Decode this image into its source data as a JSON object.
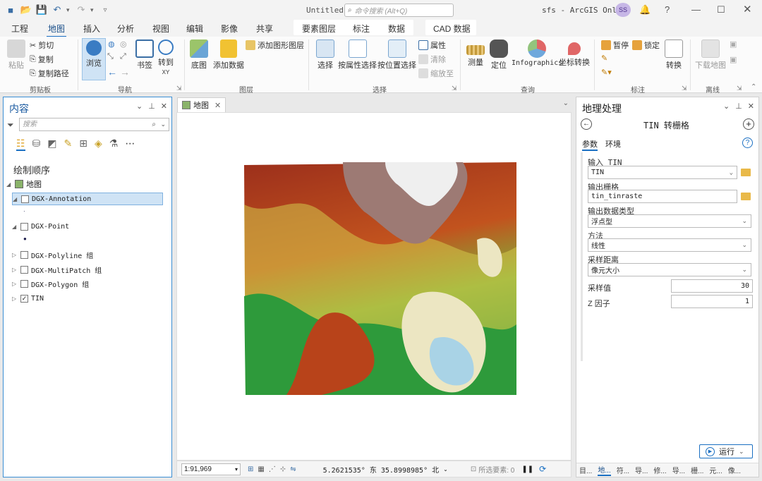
{
  "title_bar": {
    "doc_title": "Untitled",
    "search_placeholder": "命令搜索 (Alt+Q)",
    "user": "sfs - ArcGIS Online",
    "avatar_initials": "SS",
    "help": "?"
  },
  "ribbon_tabs": [
    "工程",
    "地图",
    "插入",
    "分析",
    "视图",
    "编辑",
    "影像",
    "共享",
    "要素图层",
    "标注",
    "数据",
    "CAD 数据"
  ],
  "active_tab": "地图",
  "ribbon": {
    "clipboard": {
      "paste": "粘贴",
      "cut": "剪切",
      "copy": "复制",
      "copy_path": "复制路径",
      "label": "剪贴板"
    },
    "nav": {
      "explore": "浏览",
      "bookmarks": "书签",
      "goto": "转到",
      "goto_sub": "XY",
      "label": "导航"
    },
    "layer": {
      "basemap": "底图",
      "add_data": "添加数据",
      "add_graphics": "添加图形图层",
      "label": "图层"
    },
    "selection": {
      "select": "选择",
      "by_attr": "按属性选择",
      "by_loc": "按位置选择",
      "attributes": "属性",
      "clear": "清除",
      "zoom_to": "缩放至",
      "label": "选择"
    },
    "inquiry": {
      "measure": "测量",
      "locate": "定位",
      "infographics": "Infographics",
      "coord": "坐标转换",
      "label": "查询"
    },
    "labeling": {
      "pause": "暂停",
      "lock": "锁定",
      "convert": "转换",
      "label": "标注"
    },
    "offline": {
      "download": "下载地图",
      "label": "离线"
    }
  },
  "contents": {
    "title": "内容",
    "search_placeholder": "搜索",
    "draw_order": "绘制顺序",
    "map_root": "地图",
    "layers": [
      {
        "name": "DGX-Annotation",
        "checked": false,
        "expanded": true,
        "selected": true
      },
      {
        "name": "DGX-Point",
        "checked": false,
        "expanded": true
      },
      {
        "name": "DGX-Polyline 组",
        "checked": false,
        "expanded": false
      },
      {
        "name": "DGX-MultiPatch 组",
        "checked": false,
        "expanded": false
      },
      {
        "name": "DGX-Polygon 组",
        "checked": false,
        "expanded": false
      },
      {
        "name": "TIN",
        "checked": true,
        "expanded": false
      }
    ]
  },
  "map": {
    "tab": "地图",
    "scale": "1:91,969",
    "coords": "5.2621535° 东  35.8998985° 北",
    "selected_features": "所选要素: 0"
  },
  "geoprocessing": {
    "title": "地理处理",
    "tool": "TIN 转栅格",
    "tab_params": "参数",
    "tab_env": "环境",
    "fields": {
      "input_tin_label": "输入 TIN",
      "input_tin": "TIN",
      "output_raster_label": "输出栅格",
      "output_raster": "tin_tinraste",
      "data_type_label": "输出数据类型",
      "data_type": "浮点型",
      "method_label": "方法",
      "method": "线性",
      "sampling_label": "采样距离",
      "sampling": "像元大小",
      "sample_value_label": "采样值",
      "sample_value": "30",
      "z_factor_label": "Z 因子",
      "z_factor": "1"
    },
    "run": "运行",
    "bottom_tabs": [
      "目...",
      "地...",
      "符...",
      "导...",
      "修...",
      "导...",
      "栅...",
      "元...",
      "像..."
    ]
  },
  "colors": {
    "accent": "#1a6fc2",
    "run_border": "#1a6fc2"
  }
}
